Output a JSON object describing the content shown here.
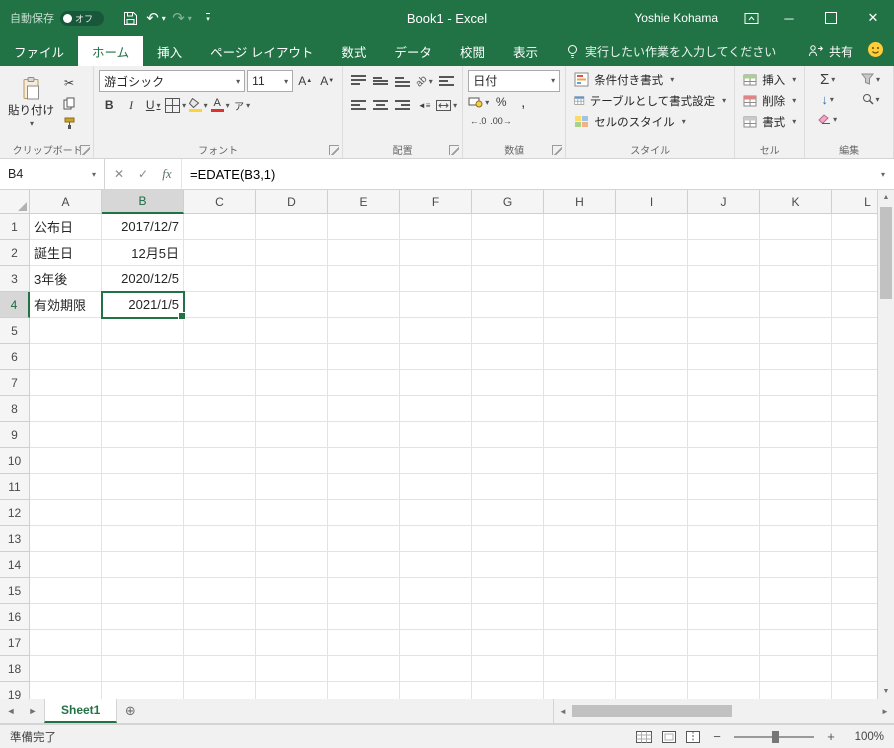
{
  "titlebar": {
    "autosave_label": "自動保存",
    "autosave_state": "オフ",
    "title": "Book1  -  Excel",
    "user": "Yoshie Kohama"
  },
  "ribbon_tabs": {
    "file": "ファイル",
    "tabs": [
      "ホーム",
      "挿入",
      "ページ レイアウト",
      "数式",
      "データ",
      "校閲",
      "表示"
    ],
    "active_tab": "ホーム",
    "tell_me": "実行したい作業を入力してください",
    "share": "共有"
  },
  "ribbon": {
    "clipboard": {
      "group_label": "クリップボード",
      "paste_label": "貼り付け"
    },
    "font": {
      "group_label": "フォント",
      "font_name": "游ゴシック",
      "font_size": "11",
      "bold_label": "B",
      "italic_label": "I",
      "underline_label": "U",
      "font_color_letter": "A",
      "grow_letter": "A",
      "shrink_letter": "A",
      "phonetic_letter": "ア"
    },
    "alignment": {
      "group_label": "配置",
      "orientation_label": "ab"
    },
    "number": {
      "group_label": "数値",
      "format": "日付",
      "percent_label": "%",
      "comma_label": ",",
      "increase_decimal_label": "←.0",
      "decrease_decimal_label": ".00→"
    },
    "styles": {
      "group_label": "スタイル",
      "conditional_label": "条件付き書式",
      "table_label": "テーブルとして書式設定",
      "cellstyles_label": "セルのスタイル"
    },
    "cells": {
      "group_label": "セル",
      "insert_label": "挿入",
      "delete_label": "削除",
      "format_label": "書式"
    },
    "editing": {
      "group_label": "編集",
      "autosum_label": "Σ",
      "fill_label": "↓"
    }
  },
  "formula_bar": {
    "name_box": "B4",
    "cancel_label": "✕",
    "enter_label": "✓",
    "fx_label": "fx",
    "formula": "=EDATE(B3,1)"
  },
  "grid": {
    "columns": [
      "A",
      "B",
      "C",
      "D",
      "E",
      "F",
      "G",
      "H",
      "I",
      "J",
      "K",
      "L"
    ],
    "row_count": 19,
    "selected_cell": {
      "col": "B",
      "row": 4
    },
    "cells": [
      {
        "row": 1,
        "col": "A",
        "value": "公布日"
      },
      {
        "row": 1,
        "col": "B",
        "value": "2017/12/7"
      },
      {
        "row": 2,
        "col": "A",
        "value": "誕生日"
      },
      {
        "row": 2,
        "col": "B",
        "value": "12月5日"
      },
      {
        "row": 3,
        "col": "A",
        "value": "3年後"
      },
      {
        "row": 3,
        "col": "B",
        "value": "2020/12/5"
      },
      {
        "row": 4,
        "col": "A",
        "value": "有効期限"
      },
      {
        "row": 4,
        "col": "B",
        "value": "2021/1/5"
      }
    ]
  },
  "sheet_bar": {
    "sheet_name": "Sheet1"
  },
  "status_bar": {
    "status": "準備完了",
    "zoom": "100%"
  },
  "colors": {
    "excel_green": "#217346",
    "selection_border": "#217346",
    "font_color_red": "#e03131",
    "fill_color_yellow": "#ffd335"
  }
}
